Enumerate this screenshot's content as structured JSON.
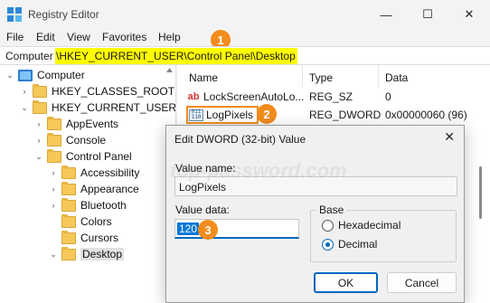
{
  "window": {
    "title": "Registry Editor",
    "controls": {
      "minimize": "—",
      "maximize": "☐",
      "close": "✕"
    }
  },
  "menu": [
    "File",
    "Edit",
    "View",
    "Favorites",
    "Help"
  ],
  "address": {
    "prefix": "Computer",
    "path": "\\HKEY_CURRENT_USER\\Control Panel\\Desktop"
  },
  "tree": {
    "items": [
      {
        "label": "Computer",
        "chev": "⌄"
      },
      {
        "label": "HKEY_CLASSES_ROOT",
        "chev": "›"
      },
      {
        "label": "HKEY_CURRENT_USER",
        "chev": "⌄"
      },
      {
        "label": "AppEvents",
        "chev": "›"
      },
      {
        "label": "Console",
        "chev": "›"
      },
      {
        "label": "Control Panel",
        "chev": "⌄"
      },
      {
        "label": "Accessibility",
        "chev": "›"
      },
      {
        "label": "Appearance",
        "chev": "›"
      },
      {
        "label": "Bluetooth",
        "chev": "›"
      },
      {
        "label": "Colors",
        "chev": ""
      },
      {
        "label": "Cursors",
        "chev": ""
      },
      {
        "label": "Desktop",
        "chev": "⌄"
      }
    ],
    "selected": "Desktop"
  },
  "list": {
    "headers": {
      "name": "Name",
      "type": "Type",
      "data": "Data"
    },
    "rows": [
      {
        "name": "LockScreenAutoLo...",
        "type": "REG_SZ",
        "data": "0",
        "icon": "ab"
      },
      {
        "name": "LogPixels",
        "type": "REG_DWORD",
        "data": "0x00000060 (96)",
        "icon": "dword"
      }
    ]
  },
  "badges": {
    "one": "1",
    "two": "2",
    "three": "3"
  },
  "dialog": {
    "title": "Edit DWORD (32-bit) Value",
    "close": "✕",
    "value_name_label": "Value name:",
    "value_name": "LogPixels",
    "value_data_label": "Value data:",
    "value_data": "120",
    "base_label": "Base",
    "hex_label": "Hexadecimal",
    "dec_label": "Decimal",
    "base_selected": "Decimal",
    "ok": "OK",
    "cancel": "Cancel"
  },
  "watermark": "top-password.com",
  "colors": {
    "highlight": "#ffff00",
    "badge": "#f28c1c",
    "accent": "#0067c0"
  }
}
